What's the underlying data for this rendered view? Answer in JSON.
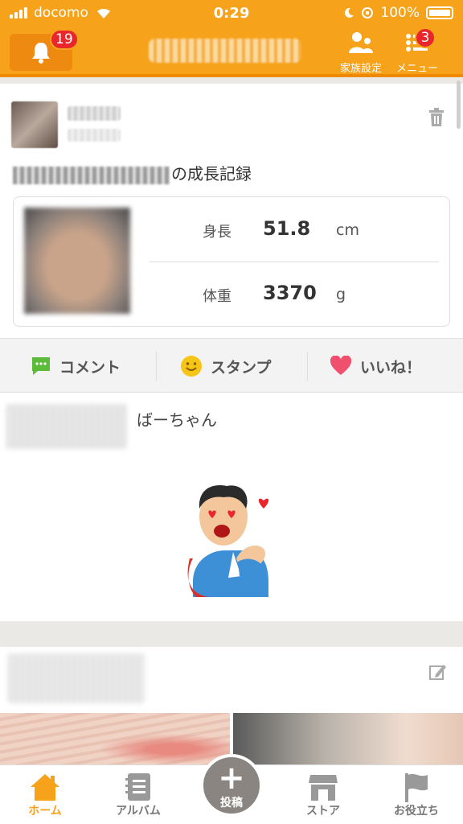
{
  "status": {
    "carrier": "docomo",
    "time": "0:29",
    "battery": "100%"
  },
  "header": {
    "notification_count": "19",
    "family_label": "家族設定",
    "menu_label": "メニュー",
    "menu_badge": "3"
  },
  "post1": {
    "title_suffix": "の成長記録",
    "height_label": "身長",
    "height_value": "51.8",
    "height_unit": "cm",
    "weight_label": "体重",
    "weight_value": "3370",
    "weight_unit": "g"
  },
  "actions": {
    "comment": "コメント",
    "stamp": "スタンプ",
    "like": "いいね！"
  },
  "post2": {
    "name_suffix": "ばーちゃん"
  },
  "tabs": {
    "home": "ホーム",
    "album": "アルバム",
    "post": "投稿",
    "store": "ストア",
    "help": "お役立ち"
  },
  "colors": {
    "brand": "#f7a21b",
    "badge": "#e8262b",
    "comment_icon": "#5dbb3a",
    "stamp_icon": "#f5c518",
    "like_icon": "#f0506e"
  }
}
